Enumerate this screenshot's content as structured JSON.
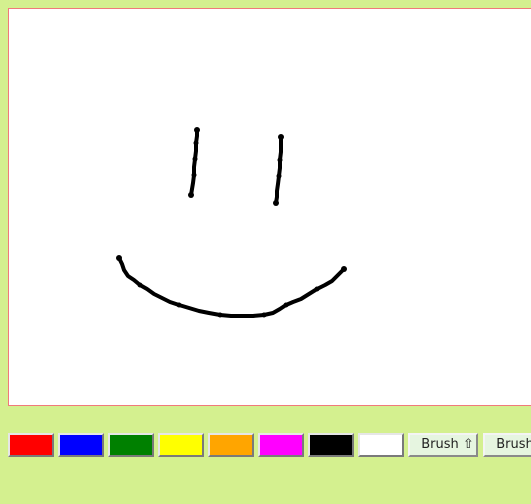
{
  "canvas": {
    "background_color": "#ffffff",
    "border_color": "#f07a7a",
    "stroke_color": "#000000"
  },
  "palette": [
    {
      "name": "red",
      "color": "#ff0000"
    },
    {
      "name": "blue",
      "color": "#0000ff"
    },
    {
      "name": "green",
      "color": "#008000"
    },
    {
      "name": "yellow",
      "color": "#ffff00"
    },
    {
      "name": "orange",
      "color": "#ffa500"
    },
    {
      "name": "magenta",
      "color": "#ff00ff"
    },
    {
      "name": "black",
      "color": "#000000"
    },
    {
      "name": "white",
      "color": "#ffffff"
    }
  ],
  "toolbar": {
    "brush_up_label": "Brush ⇧",
    "brush_down_label": "Brush ⇩"
  },
  "page_background": "#d4f08f"
}
